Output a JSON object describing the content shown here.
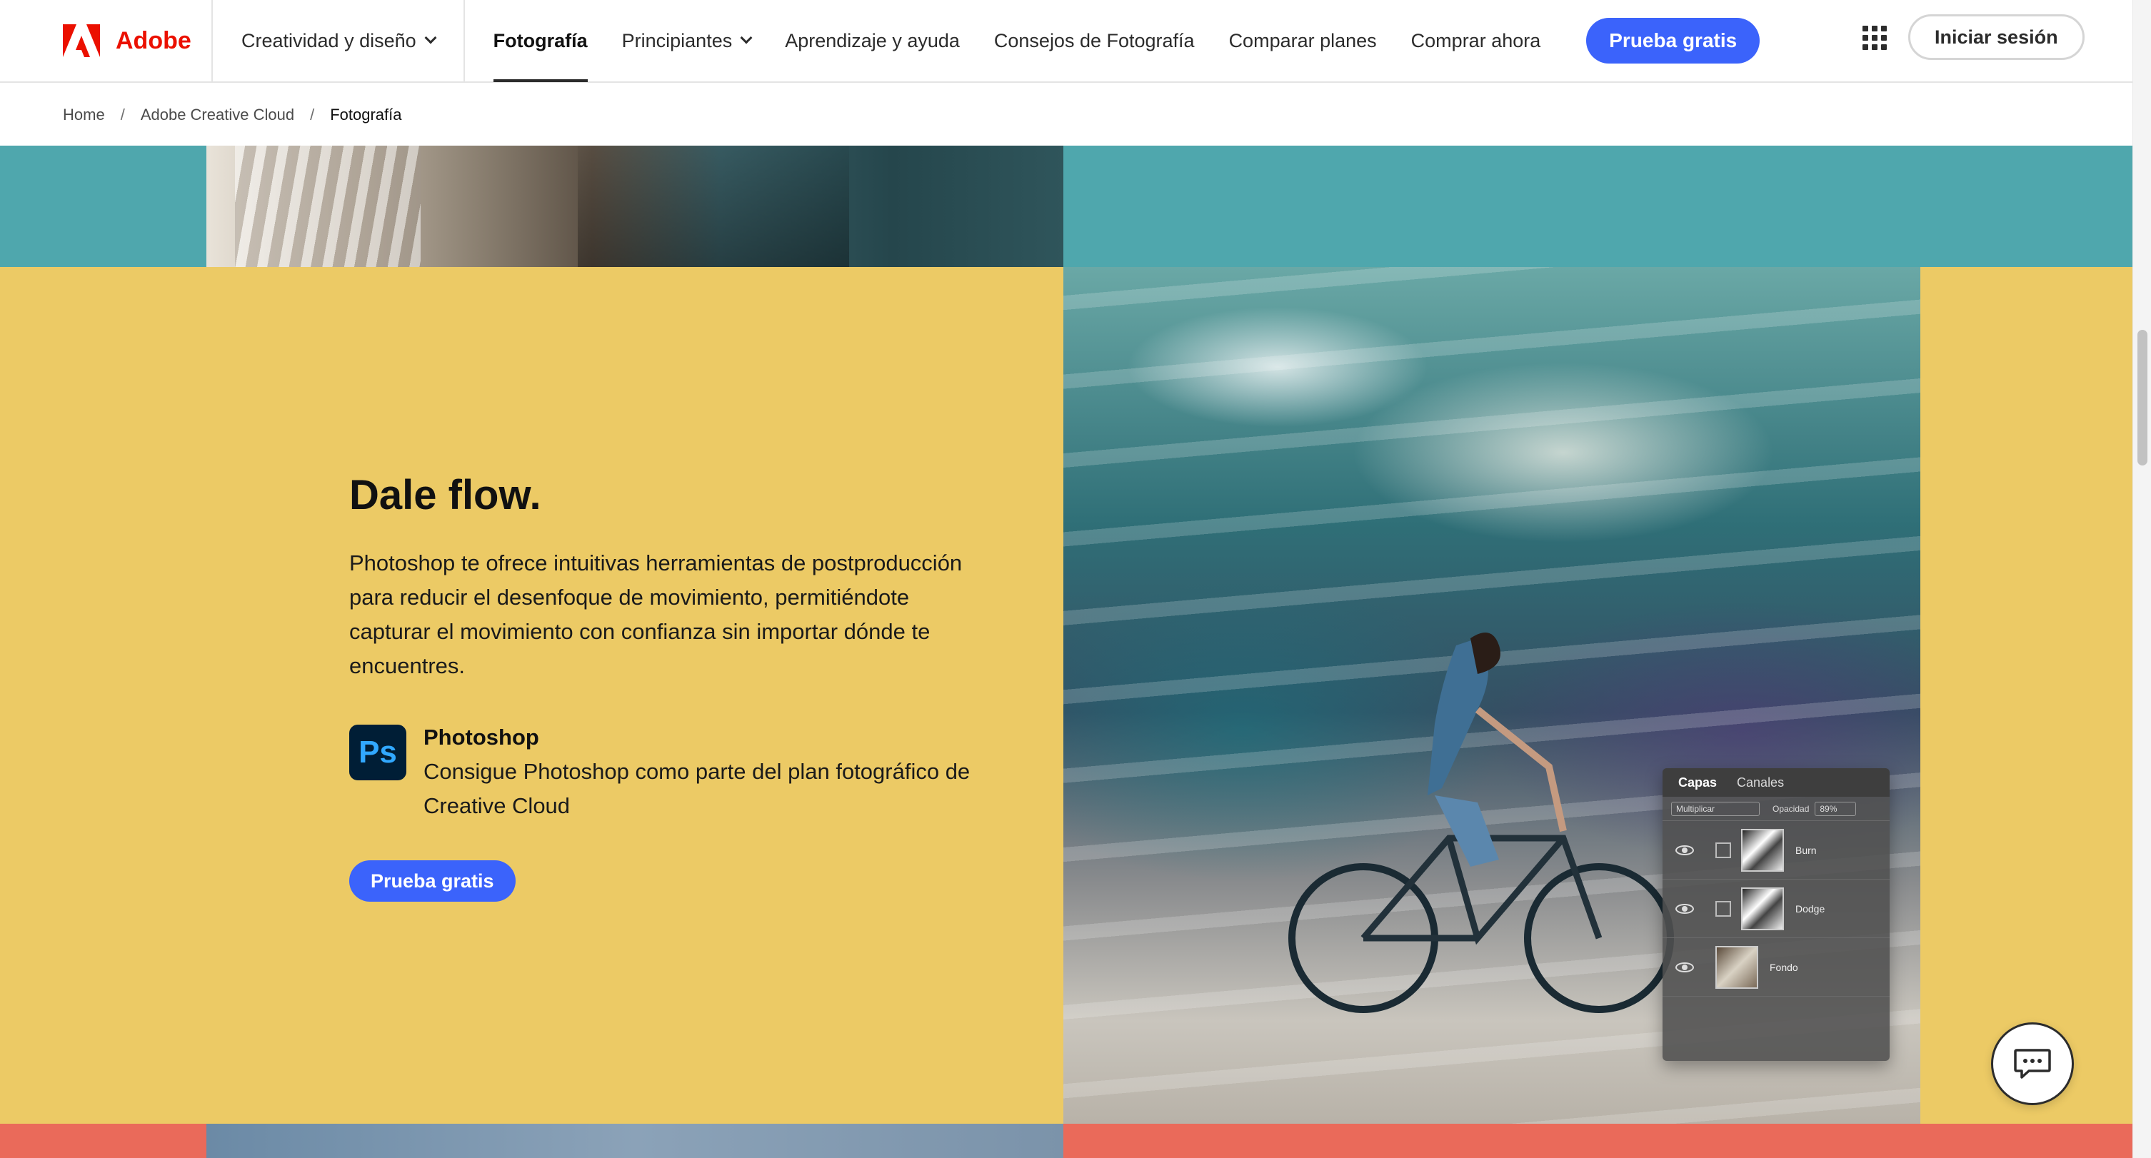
{
  "brand": {
    "name": "Adobe",
    "color": "#eb1000"
  },
  "nav": {
    "dropdown_label": "Creatividad y diseño",
    "links": [
      {
        "label": "Fotografía",
        "active": true
      },
      {
        "label": "Principiantes",
        "has_dropdown": true
      },
      {
        "label": "Aprendizaje y ayuda"
      },
      {
        "label": "Consejos de Fotografía"
      },
      {
        "label": "Comparar planes"
      },
      {
        "label": "Comprar ahora"
      }
    ],
    "cta_label": "Prueba gratis",
    "apps_icon": "app-switcher-grid-icon",
    "signin_label": "Iniciar sesión"
  },
  "breadcrumb": [
    {
      "label": "Home"
    },
    {
      "label": "Adobe Creative Cloud"
    },
    {
      "label": "Fotografía",
      "current": true
    }
  ],
  "section": {
    "headline": "Dale flow.",
    "body": "Photoshop te ofrece intuitivas herramientas de postproducción para reducir el desenfoque de movimiento, permitiéndote capturar el movimiento con confianza sin importar dónde te encuentres.",
    "product": {
      "icon_text": "Ps",
      "name": "Photoshop",
      "description": "Consigue Photoshop como parte del plan fotográfico de Creative Cloud"
    },
    "button_label": "Prueba gratis",
    "background_color": "#ecca65"
  },
  "layers_panel": {
    "tabs": [
      "Capas",
      "Canales"
    ],
    "blend_mode": "Multiplicar",
    "opacity_label": "Opacidad",
    "opacity_value": "89%",
    "layers": [
      {
        "name": "Burn"
      },
      {
        "name": "Dodge"
      },
      {
        "name": "Fondo"
      }
    ]
  },
  "colors": {
    "accent_blue": "#3b63fb",
    "teal_band": "#4fa7ad",
    "coral_band": "#ea6a5a"
  },
  "chat": {
    "icon": "chat-bubble-icon"
  }
}
